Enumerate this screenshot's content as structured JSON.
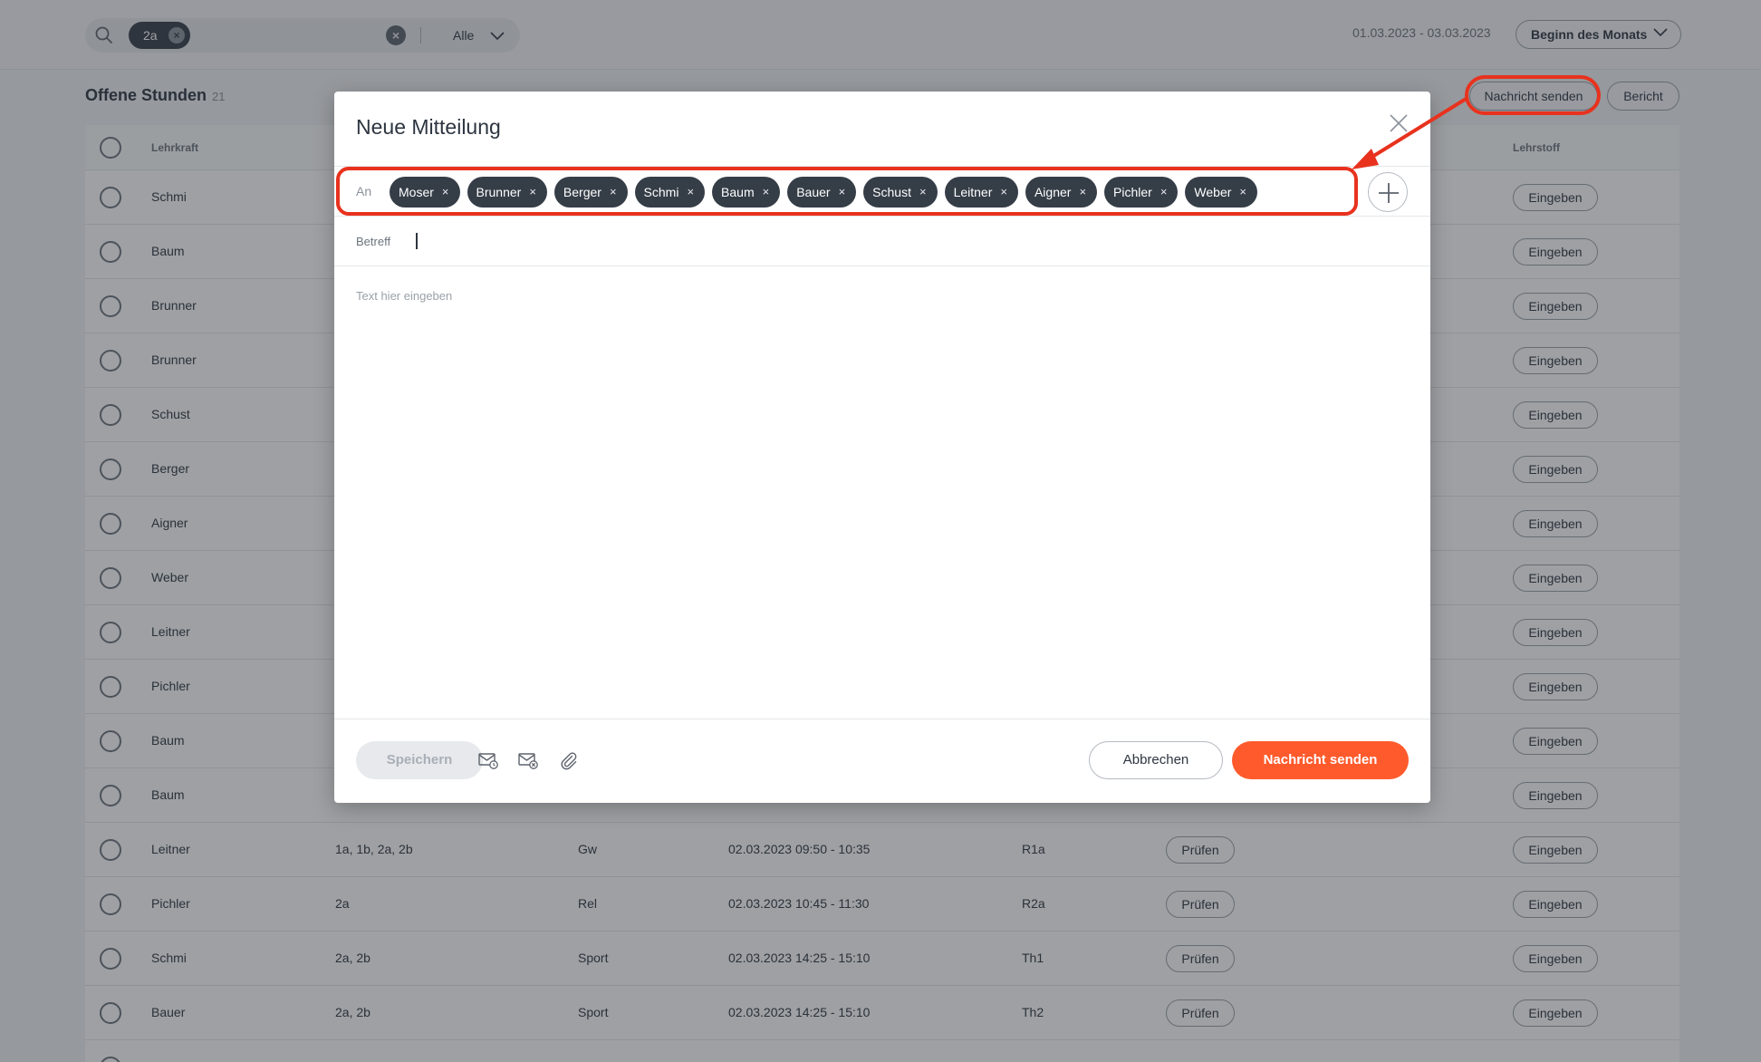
{
  "colors": {
    "accent": "#ff5a2c",
    "annotation": "#e8321e",
    "chip": "#353d47"
  },
  "topbar": {
    "filter_chip": "2a",
    "filter_select": "Alle",
    "date_range": "01.03.2023 - 03.03.2023",
    "period_select": "Beginn des Monats"
  },
  "list": {
    "title": "Offene Stunden",
    "count": "21",
    "send_button": "Nachricht senden",
    "report_button": "Bericht",
    "columns": {
      "teacher": "Lehrkraft",
      "subject_matter": "Lehrstoff"
    },
    "rows": [
      {
        "teacher": "Schmi",
        "classes": "",
        "subject": "",
        "datetime": "",
        "room": "",
        "check": "",
        "action": "Eingeben"
      },
      {
        "teacher": "Baum",
        "classes": "",
        "subject": "",
        "datetime": "",
        "room": "",
        "check": "",
        "action": "Eingeben"
      },
      {
        "teacher": "Brunner",
        "classes": "",
        "subject": "",
        "datetime": "",
        "room": "",
        "check": "",
        "action": "Eingeben"
      },
      {
        "teacher": "Brunner",
        "classes": "",
        "subject": "",
        "datetime": "",
        "room": "",
        "check": "",
        "action": "Eingeben"
      },
      {
        "teacher": "Schust",
        "classes": "",
        "subject": "",
        "datetime": "",
        "room": "",
        "check": "",
        "action": "Eingeben"
      },
      {
        "teacher": "Berger",
        "classes": "",
        "subject": "",
        "datetime": "",
        "room": "",
        "check": "",
        "action": "Eingeben"
      },
      {
        "teacher": "Aigner",
        "classes": "",
        "subject": "",
        "datetime": "",
        "room": "",
        "check": "",
        "action": "Eingeben"
      },
      {
        "teacher": "Weber",
        "classes": "",
        "subject": "",
        "datetime": "",
        "room": "",
        "check": "",
        "action": "Eingeben"
      },
      {
        "teacher": "Leitner",
        "classes": "",
        "subject": "",
        "datetime": "",
        "room": "",
        "check": "",
        "action": "Eingeben"
      },
      {
        "teacher": "Pichler",
        "classes": "",
        "subject": "",
        "datetime": "",
        "room": "",
        "check": "",
        "action": "Eingeben"
      },
      {
        "teacher": "Baum",
        "classes": "",
        "subject": "",
        "datetime": "",
        "room": "",
        "check": "",
        "action": "Eingeben"
      },
      {
        "teacher": "Baum",
        "classes": "",
        "subject": "",
        "datetime": "",
        "room": "",
        "check": "",
        "action": "Eingeben"
      },
      {
        "teacher": "Leitner",
        "classes": "1a, 1b, 2a, 2b",
        "subject": "Gw",
        "datetime": "02.03.2023 09:50 - 10:35",
        "room": "R1a",
        "check": "Prüfen",
        "action": "Eingeben"
      },
      {
        "teacher": "Pichler",
        "classes": "2a",
        "subject": "Rel",
        "datetime": "02.03.2023 10:45 - 11:30",
        "room": "R2a",
        "check": "Prüfen",
        "action": "Eingeben"
      },
      {
        "teacher": "Schmi",
        "classes": "2a, 2b",
        "subject": "Sport",
        "datetime": "02.03.2023 14:25 - 15:10",
        "room": "Th1",
        "check": "Prüfen",
        "action": "Eingeben"
      },
      {
        "teacher": "Bauer",
        "classes": "2a, 2b",
        "subject": "Sport",
        "datetime": "02.03.2023 14:25 - 15:10",
        "room": "Th2",
        "check": "Prüfen",
        "action": "Eingeben"
      },
      {
        "teacher": "",
        "classes": "",
        "subject": "",
        "datetime": "",
        "room": "",
        "check": "",
        "action": ""
      }
    ]
  },
  "modal": {
    "title": "Neue Mitteilung",
    "to_label": "An",
    "recipients": [
      "Moser",
      "Brunner",
      "Berger",
      "Schmi",
      "Baum",
      "Bauer",
      "Schust",
      "Leitner",
      "Aigner",
      "Pichler",
      "Weber"
    ],
    "remove_glyph": "×",
    "subject_label": "Betreff",
    "body_placeholder": "Text hier eingeben",
    "save_button": "Speichern",
    "cancel_button": "Abbrechen",
    "send_button": "Nachricht senden"
  }
}
